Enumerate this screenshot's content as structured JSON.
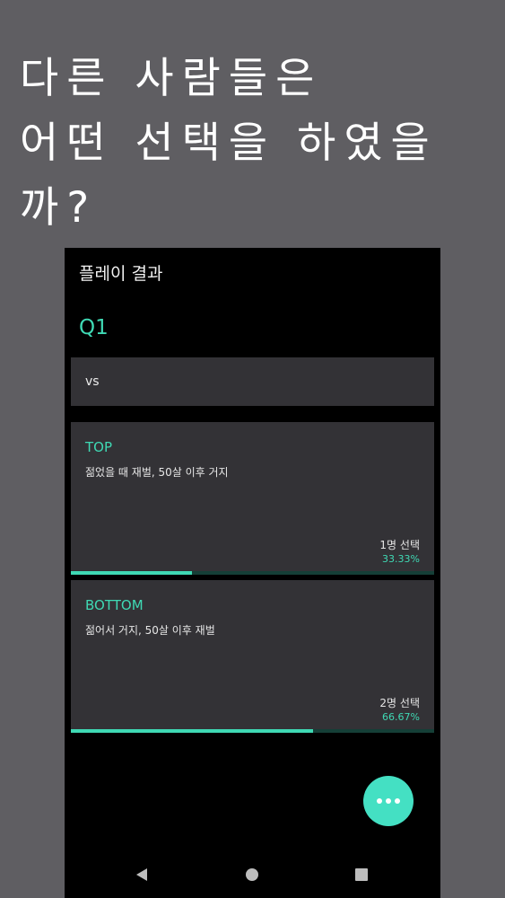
{
  "promo": {
    "line1": "다른 사람들은",
    "line2": "어떤 선택을 하였을까?"
  },
  "appbar": {
    "title": "플레이 결과"
  },
  "question": {
    "title": "Q1",
    "vs_text": "vs"
  },
  "options": [
    {
      "label": "TOP",
      "description": "젊었을 때 재벌, 50살 이후 거지",
      "count_text": "1명 선택",
      "percent_text": "33.33%",
      "fraction": 0.3333
    },
    {
      "label": "BOTTOM",
      "description": "젊어서 거지, 50살 이후 재벌",
      "count_text": "2명 선택",
      "percent_text": "66.67%",
      "fraction": 0.6667
    }
  ],
  "fab": {
    "icon": "more-horizontal-icon"
  },
  "navbar": {
    "icons": [
      "back-icon",
      "home-icon",
      "recent-apps-icon"
    ]
  },
  "colors": {
    "accent": "#3fd9b4",
    "fab": "#44e0c3",
    "card": "#333236",
    "screen_bg": "#000000",
    "promo_bg": "#5f5e62"
  }
}
